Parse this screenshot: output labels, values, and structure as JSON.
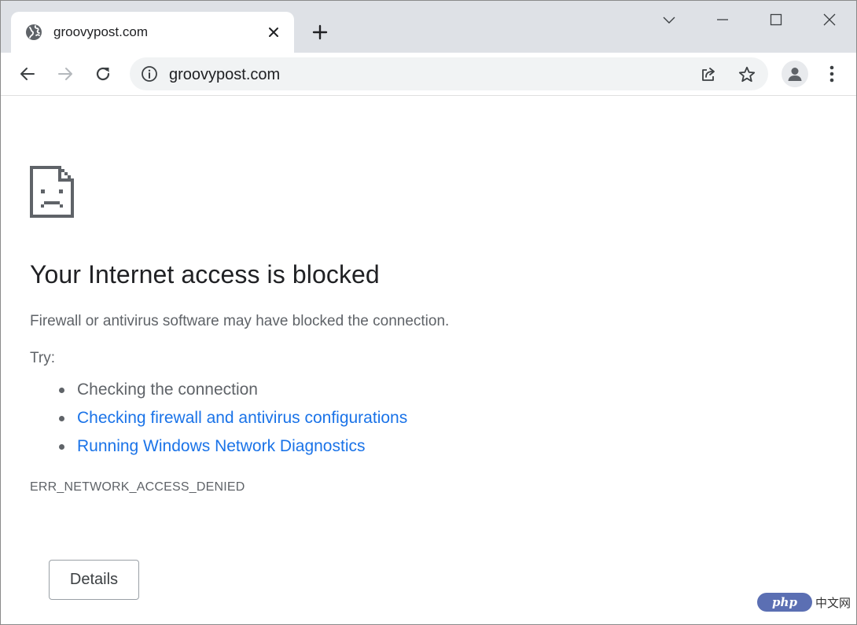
{
  "tab": {
    "favicon": "globe-icon",
    "title": "groovypost.com",
    "close_icon": "close-icon"
  },
  "new_tab_icon": "plus-icon",
  "window_controls": [
    "chevron-down-icon",
    "minimize-icon",
    "maximize-icon",
    "close-icon"
  ],
  "toolbar": {
    "back_icon": "arrow-left-icon",
    "forward_icon": "arrow-right-icon",
    "reload_icon": "reload-icon",
    "omnibox": {
      "info_icon": "info-icon",
      "url": "groovypost.com",
      "share_icon": "share-icon",
      "bookmark_icon": "star-icon"
    },
    "profile_icon": "person-icon",
    "menu_icon": "kebab-menu-icon"
  },
  "error_page": {
    "icon": "sad-page-icon",
    "headline": "Your Internet access is blocked",
    "description": "Firewall or antivirus software may have blocked the connection.",
    "try_label": "Try:",
    "suggestions": [
      {
        "text": "Checking the connection",
        "is_link": false
      },
      {
        "text": "Checking firewall and antivirus configurations",
        "is_link": true
      },
      {
        "text": "Running Windows Network Diagnostics",
        "is_link": true
      }
    ],
    "error_code": "ERR_NETWORK_ACCESS_DENIED",
    "details_button": "Details"
  },
  "watermark": {
    "logo_text": "php",
    "text": "中文网"
  },
  "colors": {
    "tabstrip_bg": "#dee1e6",
    "omnibox_bg": "#f1f3f4",
    "link": "#1a73e8",
    "text_secondary": "#5f6368",
    "text_primary": "#202124"
  }
}
